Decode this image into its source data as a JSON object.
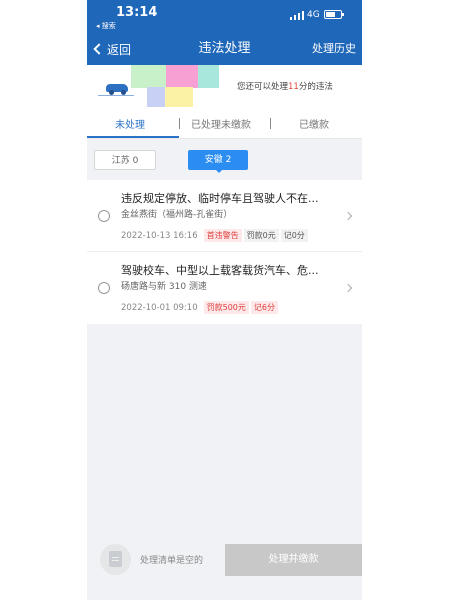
{
  "status_bar": {
    "time": "13:14",
    "back_app": "◂ 搜索",
    "network": "4G"
  },
  "nav": {
    "back_label": "返回",
    "title": "违法处理",
    "history_label": "处理历史"
  },
  "info": {
    "text_before": "您还可以处理",
    "points": "11",
    "text_after": "分的违法"
  },
  "tabs": [
    {
      "label": "未处理",
      "active": true
    },
    {
      "label": "已处理未缴款",
      "active": false
    },
    {
      "label": "已缴款",
      "active": false
    }
  ],
  "regions": [
    {
      "label": "江苏 0",
      "active": false
    },
    {
      "label": "安徽 2",
      "active": true
    }
  ],
  "violations": [
    {
      "title": "违反规定停放、临时停车且驾驶人不在...",
      "location": "金丝燕街（福州路-孔雀街）",
      "datetime": "2022-10-13 16:16",
      "tags": [
        "首违警告",
        "罚款0元",
        "记0分"
      ]
    },
    {
      "title": "驾驶校车、中型以上载客载货汽车、危...",
      "location": "砀唐路与新 310 测速",
      "datetime": "2022-10-01 09:10",
      "tags": [
        "罚款500元",
        "记6分"
      ]
    }
  ],
  "bottom": {
    "empty_text": "处理清单是空的",
    "pay_button": "处理并缴款"
  },
  "colors": {
    "brand": "#1f67b8",
    "accent": "#2b8df2",
    "warning": "#e03c3c"
  }
}
